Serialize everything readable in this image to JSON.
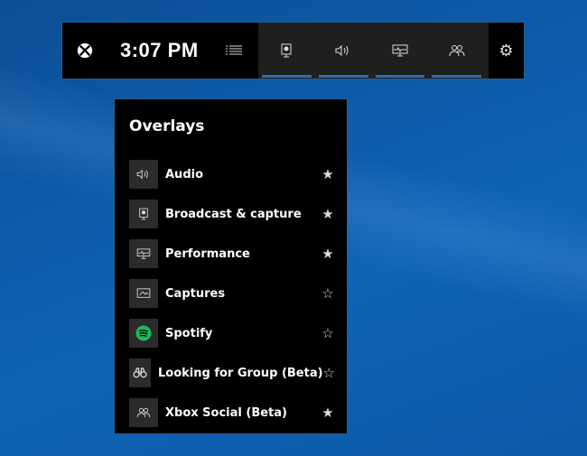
{
  "bar": {
    "time": "3:07 PM",
    "widgets": [
      "broadcast",
      "audio",
      "performance",
      "social"
    ]
  },
  "panel": {
    "title": "Overlays",
    "items": [
      {
        "label": "Audio",
        "icon": "audio-icon",
        "favorite": true
      },
      {
        "label": "Broadcast & capture",
        "icon": "broadcast-icon",
        "favorite": true
      },
      {
        "label": "Performance",
        "icon": "performance-icon",
        "favorite": true
      },
      {
        "label": "Captures",
        "icon": "captures-icon",
        "favorite": false
      },
      {
        "label": "Spotify",
        "icon": "spotify-icon",
        "favorite": false
      },
      {
        "label": "Looking for Group (Beta)",
        "icon": "binoculars-icon",
        "favorite": false
      },
      {
        "label": "Xbox Social (Beta)",
        "icon": "social-icon",
        "favorite": true
      }
    ]
  },
  "colors": {
    "accent": "#2f6eb0",
    "spotify": "#1db954"
  }
}
